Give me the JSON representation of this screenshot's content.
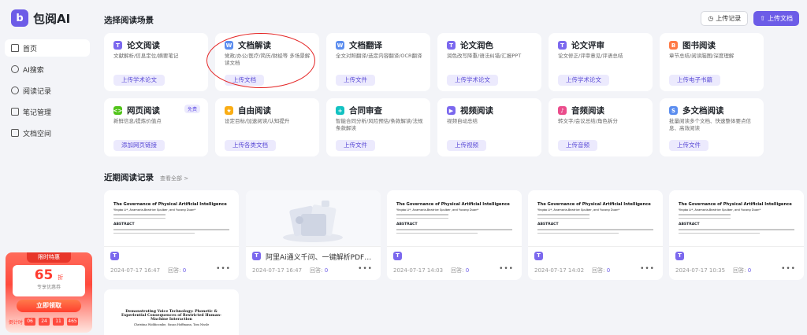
{
  "brand": {
    "name": "包阅AI",
    "logo_letter": "b",
    "accent": "#6c5ce7"
  },
  "nav": [
    {
      "label": "首页",
      "icon": "home-icon",
      "active": true
    },
    {
      "label": "AI搜索",
      "icon": "ai-search-icon"
    },
    {
      "label": "阅读记录",
      "icon": "clock-icon"
    },
    {
      "label": "笔记管理",
      "icon": "notes-icon"
    },
    {
      "label": "文档空间",
      "icon": "folder-icon"
    }
  ],
  "promo": {
    "tag": "限时特惠",
    "discount": "65",
    "discount_unit": "折",
    "sub": "专享优惠券",
    "button": "立即领取",
    "countdown_label": "倒计时",
    "countdown": [
      "06",
      "24",
      "11",
      "465"
    ]
  },
  "header": {
    "title": "选择阅读场景",
    "history_button": "上传记录",
    "upload_button": "上传文档"
  },
  "scenes": [
    {
      "title": "论文阅读",
      "desc": "文献解析/信息定位/摘要笔记",
      "button": "上传学术论文",
      "icon_letter": "T",
      "icon_color": "#7b68ee"
    },
    {
      "title": "文档解读",
      "desc": "党政/办公/医疗/简历/财经等 多场景解读文档",
      "button": "上传文档",
      "icon_letter": "W",
      "icon_color": "#5b8def"
    },
    {
      "title": "文档翻译",
      "desc": "全文对照翻译/选定内容翻译/OCR翻译",
      "button": "上传文件",
      "icon_letter": "W",
      "icon_color": "#5b8def"
    },
    {
      "title": "论文润色",
      "desc": "润色改写降重/语法纠错/汇报PPT",
      "button": "上传学术论文",
      "icon_letter": "T",
      "icon_color": "#7b68ee"
    },
    {
      "title": "论文评审",
      "desc": "论文修正/评审意见/评语总结",
      "button": "上传学术论文",
      "icon_letter": "T",
      "icon_color": "#7b68ee"
    },
    {
      "title": "图书阅读",
      "desc": "章节总结/阅读脑图/深度理解",
      "button": "上传电子书籍",
      "icon_letter": "B",
      "icon_color": "#ff7a45"
    },
    {
      "title": "网页阅读",
      "desc": "新鲜信息/提炼价值点",
      "button": "添加网页链接",
      "icon_letter": "<>",
      "icon_color": "#52c41a",
      "badge": "免费"
    },
    {
      "title": "自由阅读",
      "desc": "设定目标/加速阅读/认知提升",
      "button": "上传各类文档",
      "icon_letter": "★",
      "icon_color": "#faad14"
    },
    {
      "title": "合同审查",
      "desc": "智能合同分析/风险预估/条款解读/法规条款解读",
      "button": "上传文件",
      "icon_letter": "+",
      "icon_color": "#13c2c2"
    },
    {
      "title": "视频阅读",
      "desc": "视频自动总结",
      "button": "上传视频",
      "icon_letter": "▶",
      "icon_color": "#7b68ee"
    },
    {
      "title": "音频阅读",
      "desc": "转文字/会议总结/角色拆分",
      "button": "上传音频",
      "icon_letter": "♪",
      "icon_color": "#eb4d8c"
    },
    {
      "title": "多文档阅读",
      "desc": "批量阅读多个文档、快速整体要点信息、高效阅读",
      "button": "上传文件",
      "icon_letter": "S",
      "icon_color": "#5b8def"
    }
  ],
  "recent": {
    "title": "近期阅读记录",
    "more": "查看全部 >",
    "reply_label": "回答:",
    "docs": [
      {
        "paper_title": "The Governance of Physical Artificial Intelligence",
        "paper_authors": "Yingbo Li*, Anamaria-Beatrice Spulber, and Yucong Duan*",
        "abstract_label": "ABSTRACT",
        "name": "",
        "date": "2024-07-17 16:47",
        "replies": "0"
      },
      {
        "paper_title": "",
        "paper_authors": "",
        "abstract_label": "",
        "name": "阿里Ai通义千问、一键解析PDF…",
        "date": "2024-07-17 16:47",
        "replies": "0",
        "illustration": true
      },
      {
        "paper_title": "The Governance of Physical Artificial Intelligence",
        "paper_authors": "Yingbo Li*, Anamaria-Beatrice Spulber, and Yucong Duan*",
        "abstract_label": "ABSTRACT",
        "name": "",
        "date": "2024-07-17 14:03",
        "replies": "0"
      },
      {
        "paper_title": "The Governance of Physical Artificial Intelligence",
        "paper_authors": "Yingbo Li*, Anamaria-Beatrice Spulber, and Yucong Duan*",
        "abstract_label": "ABSTRACT",
        "name": "",
        "date": "2024-07-17 14:02",
        "replies": "0"
      },
      {
        "paper_title": "The Governance of Physical Artificial Intelligence",
        "paper_authors": "Yingbo Li*, Anamaria-Beatrice Spulber, and Yucong Duan*",
        "abstract_label": "ABSTRACT",
        "name": "",
        "date": "2024-07-17 10:35",
        "replies": "0"
      },
      {
        "paper_title": "Demonstrating Voice Technology: Phonetic & Experiential Consequences of Restricted Human-Machine Interaction",
        "paper_authors": "Christina Widdicombe, Susan Hoffmann, Tom Nissle",
        "abstract_label": "",
        "name": "",
        "date": "",
        "replies": ""
      }
    ]
  }
}
